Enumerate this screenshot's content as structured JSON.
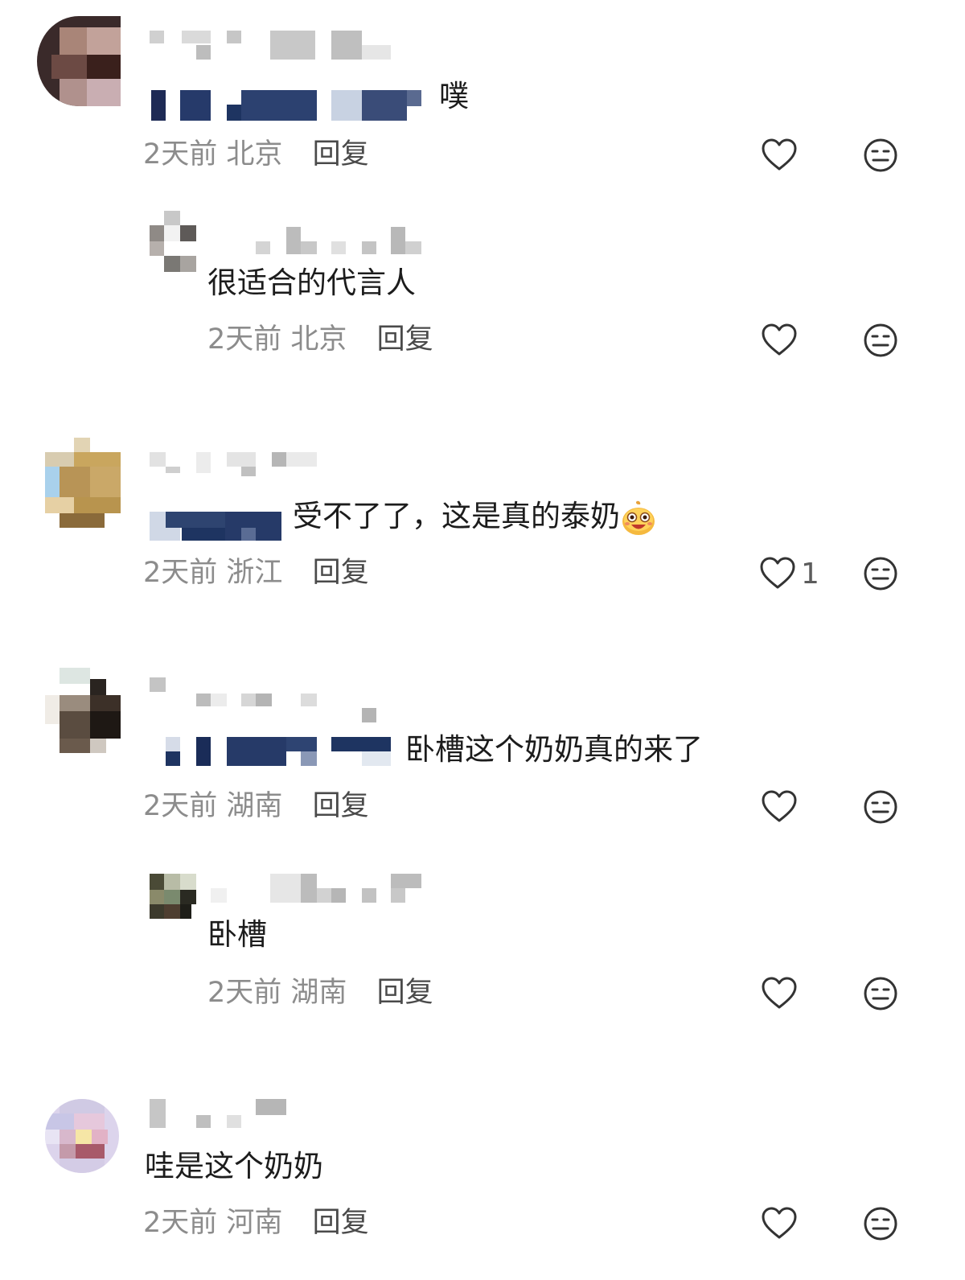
{
  "comments": [
    {
      "text": "噗",
      "time": "2天前",
      "location": "北京",
      "reply_label": "回复",
      "likes": "",
      "replies": [
        {
          "text": "很适合的代言人",
          "time": "2天前",
          "location": "北京",
          "reply_label": "回复",
          "likes": ""
        }
      ]
    },
    {
      "text": "受不了了，这是真的泰奶",
      "emoji": "laughing-face-emoji",
      "time": "2天前",
      "location": "浙江",
      "reply_label": "回复",
      "likes": "1"
    },
    {
      "text": "卧槽这个奶奶真的来了",
      "time": "2天前",
      "location": "湖南",
      "reply_label": "回复",
      "likes": "",
      "replies": [
        {
          "text": "卧槽",
          "time": "2天前",
          "location": "湖南",
          "reply_label": "回复",
          "likes": ""
        }
      ]
    },
    {
      "text": "哇是这个奶奶",
      "time": "2天前",
      "location": "河南",
      "reply_label": "回复",
      "likes": ""
    }
  ],
  "icons": {
    "like": "heart-outline-icon",
    "dislike": "neutral-face-icon"
  },
  "colors": {
    "text": "#1c1c1c",
    "meta": "#8c8c8c",
    "reply": "#4a4a4a",
    "icon": "#333333",
    "mention_blue": "#1e3461"
  }
}
